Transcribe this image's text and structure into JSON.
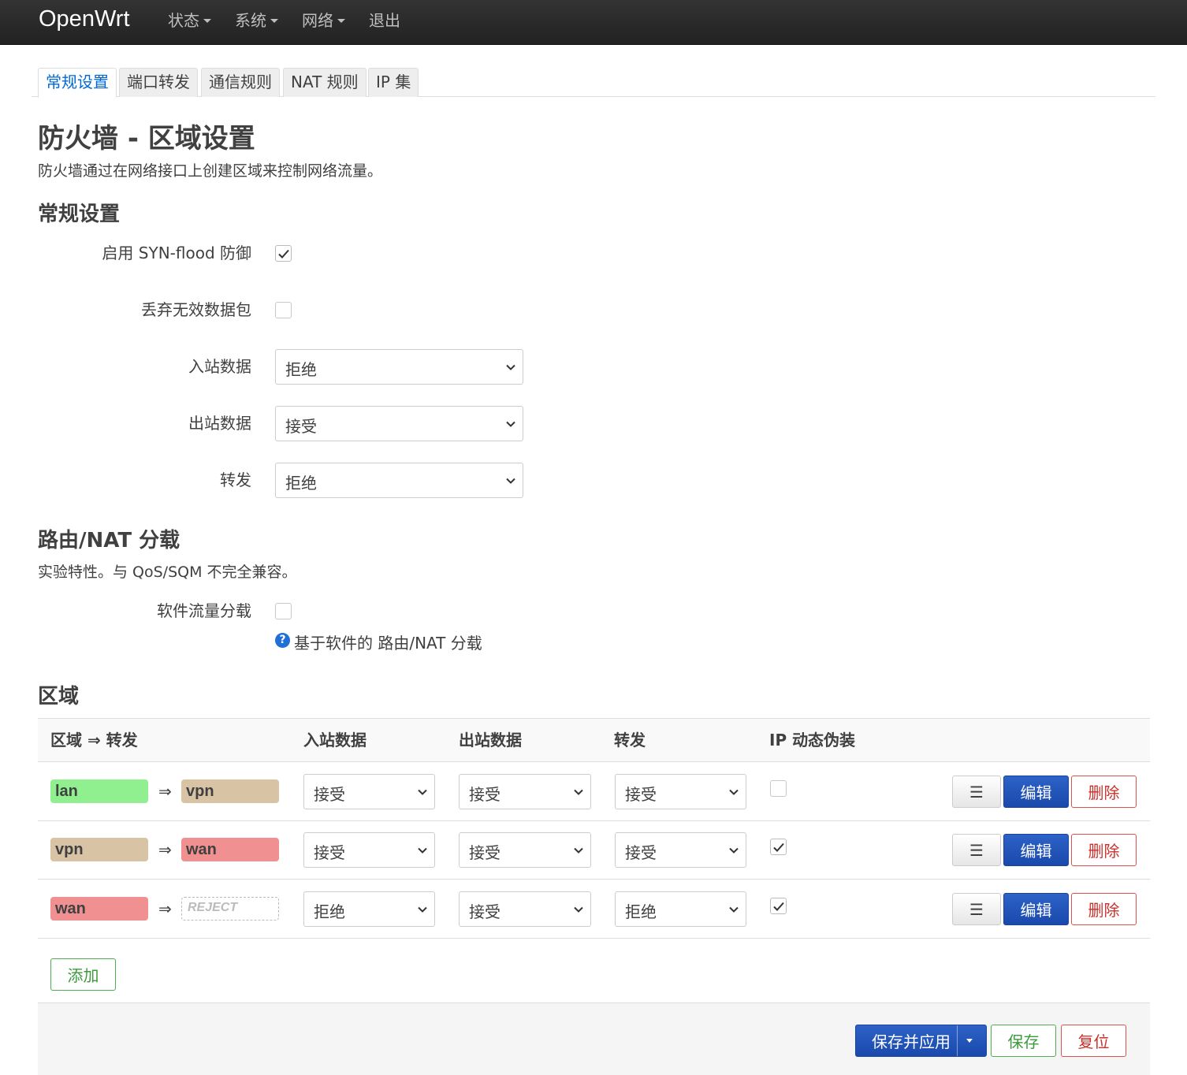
{
  "app": {
    "brand": "OpenWrt"
  },
  "nav": {
    "items": [
      {
        "label": "状态",
        "dropdown": true
      },
      {
        "label": "系统",
        "dropdown": true
      },
      {
        "label": "网络",
        "dropdown": true
      },
      {
        "label": "退出",
        "dropdown": false
      }
    ]
  },
  "tabs": [
    "常规设置",
    "端口转发",
    "通信规则",
    "NAT 规则",
    "IP 集"
  ],
  "page": {
    "title": "防火墙 - 区域设置",
    "description": "防火墙通过在网络接口上创建区域来控制网络流量。"
  },
  "general": {
    "heading": "常规设置",
    "syn_flood_label": "启用 SYN-flood 防御",
    "syn_flood_checked": true,
    "drop_invalid_label": "丢弃无效数据包",
    "drop_invalid_checked": false,
    "input_label": "入站数据",
    "input_value": "拒绝",
    "output_label": "出站数据",
    "output_value": "接受",
    "forward_label": "转发",
    "forward_value": "拒绝"
  },
  "offload": {
    "heading": "路由/NAT 分载",
    "description": "实验特性。与 QoS/SQM 不完全兼容。",
    "sw_offload_label": "软件流量分载",
    "sw_offload_checked": false,
    "help_text": "基于软件的 路由/NAT 分载"
  },
  "zones": {
    "heading": "区域",
    "columns": [
      "区域 ⇒ 转发",
      "入站数据",
      "出站数据",
      "转发",
      "IP 动态伪装"
    ],
    "rows": [
      {
        "zone": "lan",
        "zone_color": "#90f090",
        "dest": "vpn",
        "dest_color": "#d8c3a5",
        "dest_reject": false,
        "input": "接受",
        "output": "接受",
        "forward": "接受",
        "masq": false
      },
      {
        "zone": "vpn",
        "zone_color": "#d8c3a5",
        "dest": "wan",
        "dest_color": "#f09090",
        "dest_reject": false,
        "input": "接受",
        "output": "接受",
        "forward": "接受",
        "masq": true
      },
      {
        "zone": "wan",
        "zone_color": "#f09090",
        "dest": "REJECT",
        "dest_color": "#ffffff",
        "dest_reject": true,
        "input": "拒绝",
        "output": "接受",
        "forward": "拒绝",
        "masq": true
      }
    ],
    "arrow": "⇒",
    "menu_button": "☰",
    "edit_button": "编辑",
    "delete_button": "删除",
    "add_button": "添加"
  },
  "footer": {
    "apply_button": "保存并应用",
    "save_button": "保存",
    "reset_button": "复位"
  },
  "colors": {
    "primary": "#1a49ac",
    "link": "#0069d6",
    "danger": "#c9302c",
    "success": "#3c9a3c"
  }
}
